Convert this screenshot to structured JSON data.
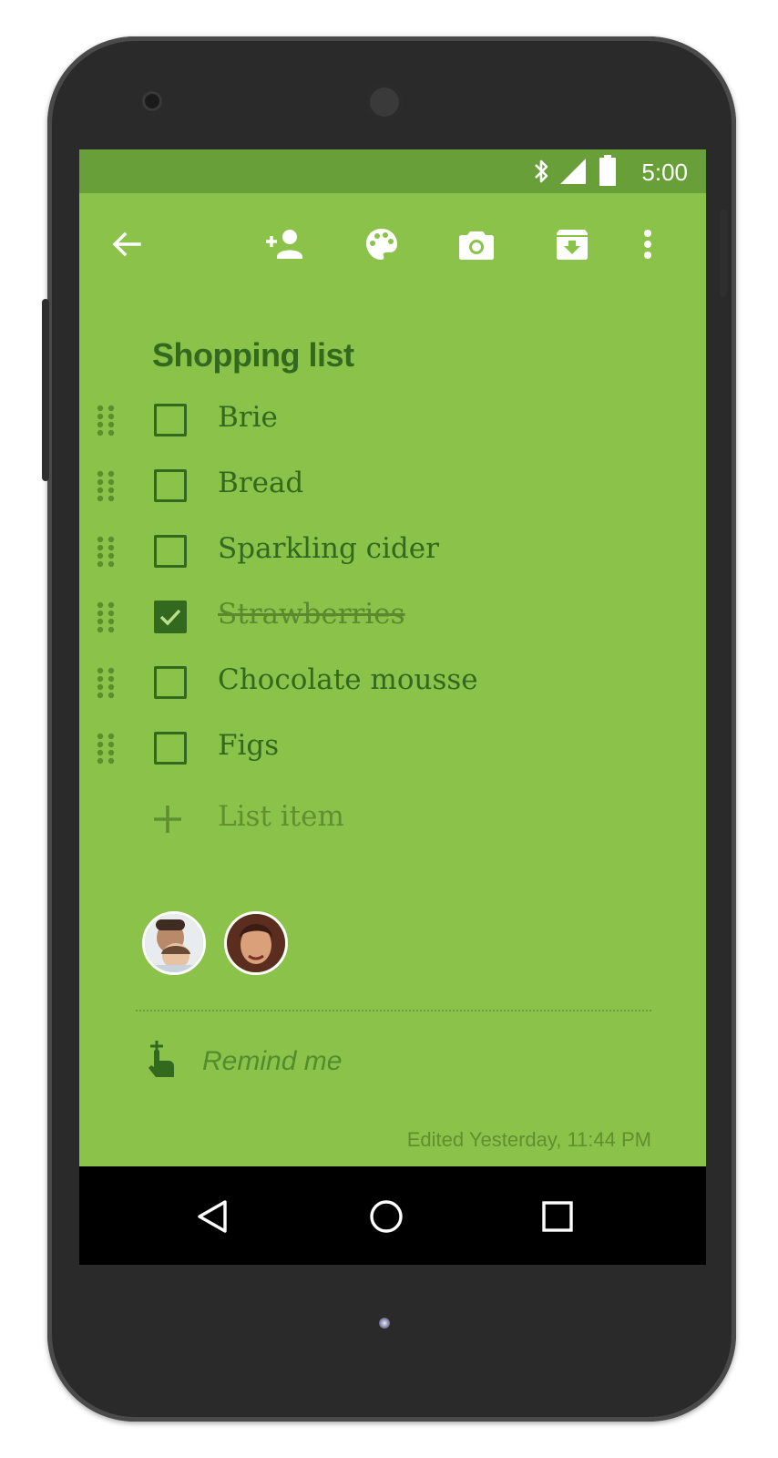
{
  "status_bar": {
    "time": "5:00",
    "icons": [
      "bluetooth-icon",
      "signal-icon",
      "battery-icon"
    ]
  },
  "toolbar": {
    "icons": [
      "back-arrow-icon",
      "add-collaborator-icon",
      "palette-icon",
      "camera-icon",
      "archive-icon",
      "more-vert-icon"
    ]
  },
  "note": {
    "title": "Shopping list",
    "items": [
      {
        "text": "Brie",
        "checked": false
      },
      {
        "text": "Bread",
        "checked": false
      },
      {
        "text": "Sparkling cider",
        "checked": false
      },
      {
        "text": "Strawberries",
        "checked": true
      },
      {
        "text": "Chocolate mousse",
        "checked": false
      },
      {
        "text": "Figs",
        "checked": false
      }
    ],
    "add_item_placeholder": "List item",
    "remind_label": "Remind me",
    "edited": "Edited Yesterday, 11:44 PM"
  },
  "collaborators": [
    "avatar-1",
    "avatar-2"
  ],
  "nav_bar": {
    "icons": [
      "back-triangle-icon",
      "home-circle-icon",
      "recents-square-icon"
    ]
  },
  "colors": {
    "note_background": "#8bc34a",
    "status_bar": "#689f38",
    "text_dark_green": "#33691e"
  }
}
